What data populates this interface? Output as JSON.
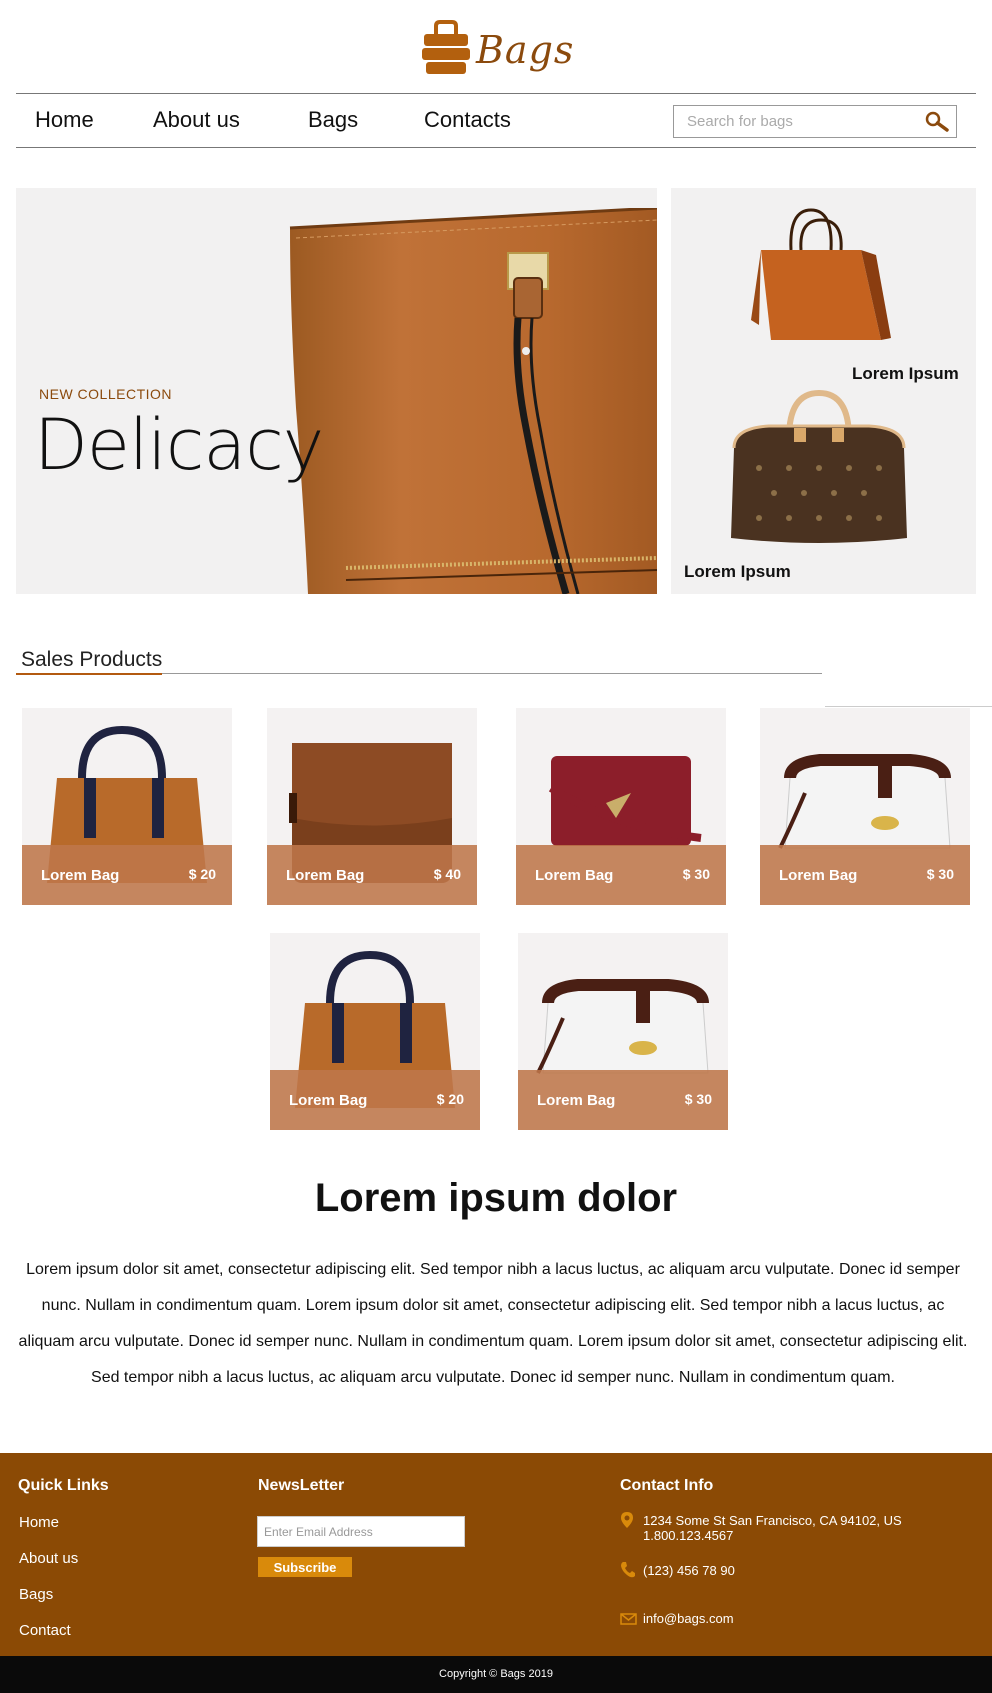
{
  "brand": {
    "name": "Bags",
    "color": "#8b4a0d"
  },
  "nav": {
    "items": [
      {
        "label": "Home"
      },
      {
        "label": "About us"
      },
      {
        "label": "Bags"
      },
      {
        "label": "Contacts"
      }
    ],
    "search_placeholder": "Search for bags",
    "search_icon": "search-icon"
  },
  "hero": {
    "eyebrow": "NEW COLLECTION",
    "title": "Delicacy"
  },
  "side": {
    "items": [
      {
        "label": "Lorem Ipsum"
      },
      {
        "label": "Lorem Ipsum"
      }
    ]
  },
  "sales": {
    "title": "Sales Products",
    "products": [
      {
        "name": "Lorem Bag",
        "price": "$ 20"
      },
      {
        "name": "Lorem Bag",
        "price": "$ 40"
      },
      {
        "name": "Lorem Bag",
        "price": "$ 30"
      },
      {
        "name": "Lorem Bag",
        "price": "$ 30"
      },
      {
        "name": "Lorem Bag",
        "price": "$ 20"
      },
      {
        "name": "Lorem Bag",
        "price": "$ 30"
      }
    ]
  },
  "about": {
    "title": "Lorem ipsum dolor",
    "text": "Lorem ipsum dolor sit amet, consectetur adipiscing elit. Sed tempor nibh a lacus luctus, ac aliquam arcu vulputate. Donec id semper nunc. Nullam in condimentum quam.  Lorem ipsum dolor sit amet, consectetur adipiscing elit. Sed tempor nibh a lacus luctus, ac aliquam arcu vulputate. Donec id semper nunc. Nullam in condimentum quam. Lorem ipsum dolor sit amet, consectetur adipiscing elit. Sed tempor nibh a lacus luctus, ac aliquam arcu vulputate. Donec id semper nunc. Nullam in condimentum quam."
  },
  "footer": {
    "quick_links_title": "Quick Links",
    "links": [
      "Home",
      "About us",
      "Bags",
      "Contact"
    ],
    "newsletter_title": "NewsLetter",
    "email_placeholder": "Enter Email Address",
    "subscribe_label": "Subscribe",
    "contact_title": "Contact Info",
    "address": "1234 Some St San Francisco, CA 94102, US 1.800.123.4567",
    "phone": "(123) 456 78 90",
    "email": "info@bags.com",
    "bg_color": "#8b4a05",
    "accent_color": "#d98a0b"
  },
  "copyright": "Copyright © Bags 2019"
}
